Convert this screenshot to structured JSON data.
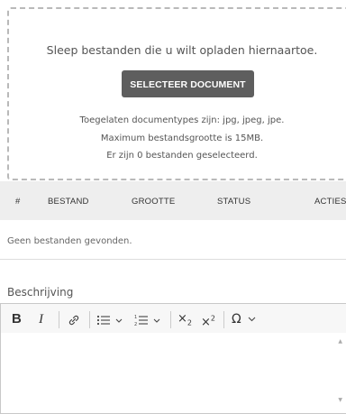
{
  "upload": {
    "drop_text": "Sleep bestanden die u wilt opladen hiernaartoe.",
    "select_button": "SELECTEER DOCUMENT",
    "allowed_types": "Toegelaten documentypes zijn: jpg, jpeg, jpe.",
    "max_size": "Maximum bestandsgrootte is 15MB.",
    "selected_count": "Er zijn 0 bestanden geselecteerd."
  },
  "table": {
    "headers": [
      "#",
      "BESTAND",
      "GROOTTE",
      "STATUS",
      "ACTIES"
    ],
    "empty_text": "Geen bestanden gevonden."
  },
  "description": {
    "label": "Beschrijving"
  },
  "toolbar": {
    "bold": "B",
    "italic": "I",
    "link": "link-icon",
    "bulleted_list": "bulleted-list-icon",
    "numbered_list": "numbered-list-icon",
    "subscript": "subscript-icon",
    "superscript": "superscript-icon",
    "special_chars": "Ω"
  }
}
